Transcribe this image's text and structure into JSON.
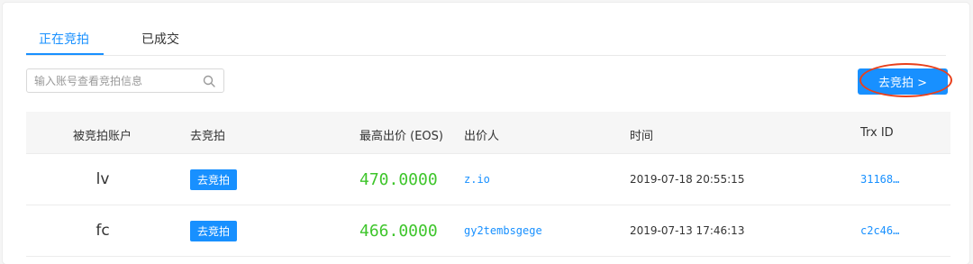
{
  "tabs": [
    {
      "label": "正在竞拍",
      "active": true
    },
    {
      "label": "已成交",
      "active": false
    }
  ],
  "search": {
    "placeholder": "输入账号查看竞拍信息",
    "value": "",
    "icon": "search-icon"
  },
  "go_button": {
    "label": "去竞拍 >"
  },
  "table": {
    "headers": [
      "被竞拍账户",
      "去竞拍",
      "最高出价 (EOS)",
      "出价人",
      "时间",
      "Trx ID"
    ],
    "rows": [
      {
        "account": "lv",
        "action": "去竞拍",
        "bid": "470.0000",
        "bidder": "z.io",
        "time": "2019-07-18 20:55:15",
        "trx": "31168…"
      },
      {
        "account": "fc",
        "action": "去竞拍",
        "bid": "466.0000",
        "bidder": "gy2tembsgege",
        "time": "2019-07-13 17:46:13",
        "trx": "c2c46…"
      }
    ]
  },
  "colors": {
    "accent": "#1890ff",
    "bid_green": "#3ec52b",
    "highlight": "#e8401c"
  }
}
